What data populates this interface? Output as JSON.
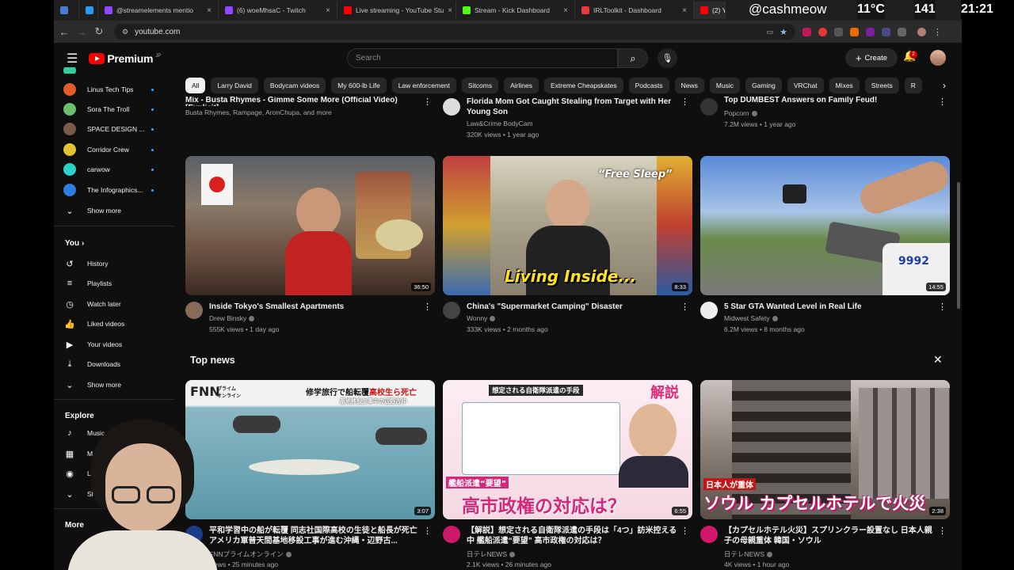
{
  "browser": {
    "tabs": [
      {
        "title": "",
        "color": "#4a7bd6"
      },
      {
        "title": "",
        "color": "#2b9af3"
      },
      {
        "title": "@streamelements mentio",
        "color": "#9146ff"
      },
      {
        "title": "(6) woeMhsaC - Twitch",
        "color": "#9146ff"
      },
      {
        "title": "Live streaming - YouTube Stu",
        "color": "#ff0000"
      },
      {
        "title": "Stream - Kick Dashboard",
        "color": "#53fc18"
      },
      {
        "title": "IRLToolkit - Dashboard",
        "color": "#e33b3b"
      },
      {
        "title": "(2) Y",
        "color": "#ff0000"
      }
    ],
    "url": "youtube.com"
  },
  "overlay": {
    "handle": "@cashmeow",
    "temperature": "11°C",
    "number": "141",
    "time": "21:21"
  },
  "header": {
    "logo": "Premium",
    "logo_region": "JP",
    "search_placeholder": "Search",
    "create_label": "Create",
    "notification_count": "2"
  },
  "sidebar": {
    "subscriptions": [
      {
        "label": "Linus Tech Tips",
        "color": "#e25c2a"
      },
      {
        "label": "Sora The Troll",
        "color": "#6bc06b"
      },
      {
        "label": "SPACE DESIGN ...",
        "color": "#7a5a4a"
      },
      {
        "label": "Corridor Crew",
        "color": "#e2c230"
      },
      {
        "label": "carwow",
        "color": "#2bd0c8"
      },
      {
        "label": "The Infographics...",
        "color": "#2f7de1"
      }
    ],
    "show_more_1": "Show more",
    "you_heading": "You",
    "you_items": [
      "History",
      "Playlists",
      "Watch later",
      "Liked videos",
      "Your videos",
      "Downloads"
    ],
    "show_more_2": "Show more",
    "explore_heading": "Explore",
    "explore_items": [
      "Music",
      "Movies & TV",
      "Live"
    ],
    "show_more_3": "Show more",
    "more_heading": "More"
  },
  "chips": [
    "All",
    "Larry David",
    "Bodycam videos",
    "My 600-lb Life",
    "Law enforcement",
    "Sitcoms",
    "Airlines",
    "Extreme Cheapskates",
    "Podcasts",
    "News",
    "Music",
    "Gaming",
    "VRChat",
    "Mixes",
    "Streets",
    "R"
  ],
  "row_partial": [
    {
      "title": "Mix - Busta Rhymes - Gimme Some More (Official Video) [Explicit]",
      "channel": "Busta Rhymes, Rampage, AronChupa, and more",
      "stats": ""
    },
    {
      "title": "Florida Mom Got Caught Stealing from Target with Her Young Son",
      "channel": "Law&Crime BodyCam",
      "stats": "320K views • 1 year ago"
    },
    {
      "title": "Top DUMBEST Answers on Family Feud!",
      "channel": "Popcorn",
      "stats": "7.2M views • 1 year ago"
    }
  ],
  "row_videos": [
    {
      "title": "Inside Tokyo's Smallest Apartments",
      "channel": "Drew Binsky",
      "stats": "555K views • 1 day ago",
      "duration": "36:50"
    },
    {
      "title": "China's \"Supermarket Camping\" Disaster",
      "channel": "Wonny",
      "stats": "333K views • 2 months ago",
      "duration": "8:33",
      "overlay_1": "“Free Sleep”",
      "overlay_2": "Living Inside..."
    },
    {
      "title": "5 Star GTA Wanted Level in Real Life",
      "channel": "Midwest Safety",
      "stats": "6.2M views • 8 months ago",
      "duration": "14:55",
      "car_number": "9992"
    }
  ],
  "top_news": {
    "heading": "Top news",
    "items": [
      {
        "title": "平和学習中の船が転覆 同志社国際高校の生徒と船長が死亡 アメリカ軍普天間基地移設工事が進む沖縄・辺野古...",
        "channel": "FNNプライムオンライン",
        "stats": "views • 25 minutes ago",
        "duration": "3:07",
        "badge": "FNN",
        "badge_sub": "プライム オンライン",
        "headline": "修学旅行で船転覆",
        "headline_red": "高校生ら死亡",
        "caption": "基地移設工事中の辺野古沖"
      },
      {
        "title": "【解説】想定される自衛隊派遣の手段は「4つ」訪米控える中 艦船派遣“要望” 高市政権の対応は？",
        "channel": "日テレNEWS",
        "stats": "2.1K views • 26 minutes ago",
        "duration": "6:55",
        "kaisetsu": "解説",
        "box_title": "想定される自衛隊派遣の手段",
        "subline": "艦船派遣“要望”",
        "big": "高市政権の対応は？"
      },
      {
        "title": "【カプセルホテル火災】スプリンクラー設置なし 日本人親子の母親重体 韓国・ソウル",
        "channel": "日テレNEWS",
        "stats": "4K views • 1 hour ago",
        "duration": "2:38",
        "subline": "日本人が重体",
        "big": "ソウル カプセルホテルで火災"
      }
    ]
  }
}
